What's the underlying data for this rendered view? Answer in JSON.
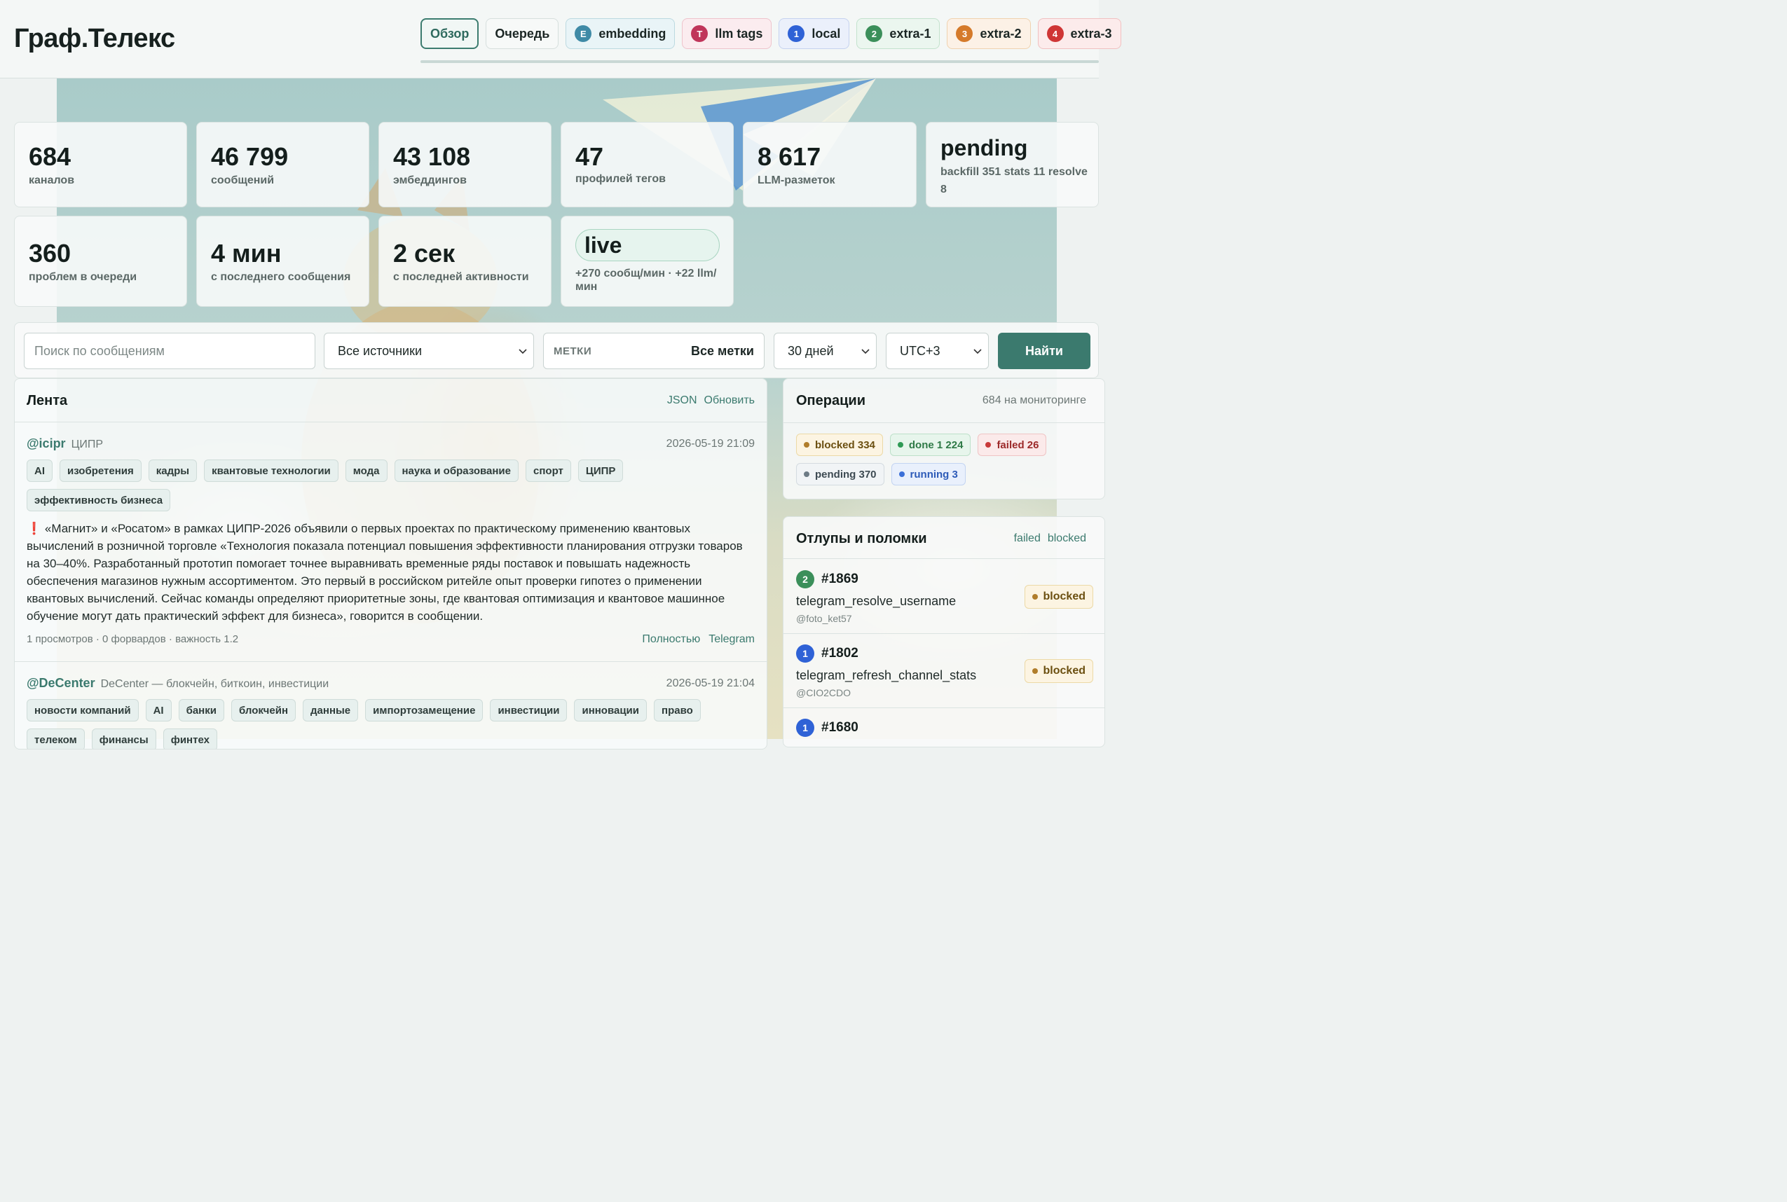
{
  "brand": "Граф.Телекс",
  "nav": [
    {
      "label": "Обзор",
      "badge": "",
      "variant": "active"
    },
    {
      "label": "Очередь",
      "badge": "",
      "variant": "plain"
    },
    {
      "label": "embedding",
      "badge": "E",
      "variant": "emb",
      "color": "#3f8aa6"
    },
    {
      "label": "llm tags",
      "badge": "T",
      "variant": "llm",
      "color": "#c0355a"
    },
    {
      "label": "local",
      "badge": "1",
      "variant": "loc",
      "color": "#2f62d6"
    },
    {
      "label": "extra-1",
      "badge": "2",
      "variant": "ex1",
      "color": "#3b8f5a"
    },
    {
      "label": "extra-2",
      "badge": "3",
      "variant": "ex2",
      "color": "#d57a2a"
    },
    {
      "label": "extra-3",
      "badge": "4",
      "variant": "ex3",
      "color": "#cf3535"
    }
  ],
  "stats": {
    "channels": {
      "value": "684",
      "label": "каналов"
    },
    "messages": {
      "value": "46 799",
      "label": "сообщений"
    },
    "embeddings": {
      "value": "43 108",
      "label": "эмбеддингов"
    },
    "tag_profiles": {
      "value": "47",
      "label": "профилей тегов"
    },
    "llm_marks": {
      "value": "8 617",
      "label": "LLM-разметок"
    },
    "pending": {
      "value": "pending",
      "sub": "backfill 351  stats 11 resolve 8"
    },
    "queue_problems": {
      "value": "360",
      "label": "проблем в очереди"
    },
    "last_message": {
      "value": "4 мин",
      "label": "с последнего сообщения"
    },
    "last_activity": {
      "value": "2 сек",
      "label": "с последней активности"
    },
    "live": {
      "value": "live",
      "sub": "+270 сообщ/мин · +22 llm/мин"
    }
  },
  "filters": {
    "search_placeholder": "Поиск по сообщениям",
    "source": "Все источники",
    "tags_label": "МЕТКИ",
    "tags_value": "Все метки",
    "period": "30 дней",
    "timezone": "UTC+3",
    "submit": "Найти"
  },
  "feed": {
    "title": "Лента",
    "links": [
      "JSON",
      "Обновить"
    ],
    "posts": [
      {
        "author": "@icipr",
        "source": "ЦИПР",
        "date": "2026-05-19 21:09",
        "tags": [
          "AI",
          "изобретения",
          "кадры",
          "квантовые технологии",
          "мода",
          "наука и образование",
          "спорт",
          "ЦИПР",
          "эффективность бизнеса"
        ],
        "mark": "❗",
        "text": "«Магнит» и «Росатом» в рамках ЦИПР-2026 объявили о первых проектах по практическому применению квантовых вычислений в розничной торговле «Технология показала потенциал повышения эффективности планирования отгрузки товаров на 30–40%. Разработанный прототип помогает точнее выравнивать временные ряды поставок и повышать надежность обеспечения магазинов нужным ассортиментом. Это первый в российском ритейле опыт проверки гипотез о применении квантовых вычислений. Сейчас команды определяют приоритетные зоны, где квантовая оптимизация и квантовое машинное обучение могут дать практический эффект для бизнеса», говорится в сообщении.",
        "meta": "1 просмотров · 0 форвардов · важность 1.2",
        "actions": [
          "Полностью",
          "Telegram"
        ]
      },
      {
        "author": "@DeCenter",
        "source": "DeCenter — блокчейн, биткоин, инвестиции",
        "date": "2026-05-19 21:04",
        "tags": [
          "новости компаний",
          "AI",
          "банки",
          "блокчейн",
          "данные",
          "импортозамещение",
          "инвестиции",
          "инновации",
          "право",
          "телеком",
          "финансы",
          "финтех"
        ]
      }
    ]
  },
  "operations": {
    "title": "Операции",
    "monitoring": "684 на мониторинге",
    "chips": [
      {
        "label": "blocked 334",
        "kind": "blocked"
      },
      {
        "label": "done 1 224",
        "kind": "done"
      },
      {
        "label": "failed 26",
        "kind": "failed"
      },
      {
        "label": "pending 370",
        "kind": "pending"
      },
      {
        "label": "running 3",
        "kind": "running"
      }
    ]
  },
  "failures": {
    "title": "Отлупы и поломки",
    "links": [
      "failed",
      "blocked"
    ],
    "items": [
      {
        "badge": "2",
        "color": "#3b8f5a",
        "id": "#1869",
        "task": "telegram_resolve_username",
        "user": "@foto_ket57",
        "status": "blocked"
      },
      {
        "badge": "1",
        "color": "#2f62d6",
        "id": "#1802",
        "task": "telegram_refresh_channel_stats",
        "user": "@CIO2CDO",
        "status": "blocked"
      },
      {
        "badge": "1",
        "color": "#2f62d6",
        "id": "#1680",
        "task": "",
        "user": "",
        "status": ""
      }
    ]
  }
}
